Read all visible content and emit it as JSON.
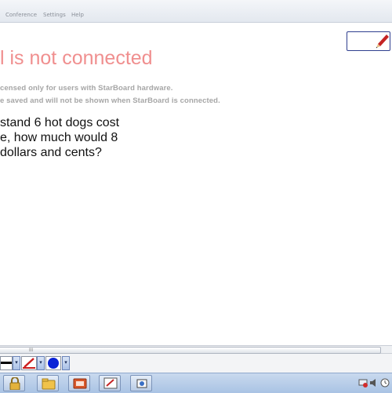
{
  "menu": {
    "items": [
      "Conference",
      "Settings",
      "Help"
    ]
  },
  "warning": {
    "title": "l is not connected",
    "notices": [
      "censed only for users with StarBoard hardware.",
      "e saved and will not be shown when StarBoard is connected."
    ]
  },
  "question": {
    "lines": [
      "stand 6 hot dogs cost",
      "e, how much would 8",
      " dollars and cents?"
    ]
  },
  "scrollbar": {
    "grip": "III"
  },
  "toolbar": {
    "line_color": "#000000",
    "pen_color": "#cc1f1f",
    "fill_color": "#0a22d6",
    "dropdown_glyph": "▾"
  },
  "taskbar": {
    "buttons": [
      "lock-icon",
      "folder-icon",
      "presentation-icon",
      "whiteboard-icon",
      "tools-icon"
    ],
    "tray": [
      "network-icon",
      "speaker-icon",
      "clock-icon"
    ]
  },
  "icons": {
    "pen": "pen-icon",
    "lock": "lock-icon"
  }
}
